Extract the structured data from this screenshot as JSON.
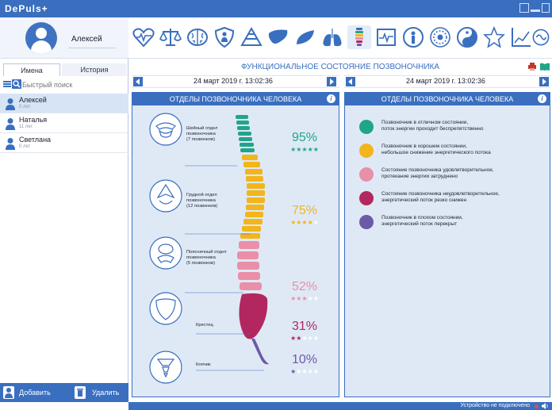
{
  "app": {
    "title": "DePuls+"
  },
  "profile": {
    "name": "Алексей"
  },
  "tabs": [
    {
      "label": "Имена"
    },
    {
      "label": "История"
    }
  ],
  "search": {
    "placeholder": "Быстрый поиск"
  },
  "users": [
    {
      "name": "Алексей",
      "age": "0 лет"
    },
    {
      "name": "Наталья",
      "age": "11 лет"
    },
    {
      "name": "Светлана",
      "age": "0 лет"
    }
  ],
  "bottom": {
    "add_label": "Добавить",
    "delete_label": "Удалить"
  },
  "toolbar": {
    "icons": [
      "heart-pulse-icon",
      "scales-icon",
      "brain-icon",
      "shield-person-icon",
      "pyramid-icon",
      "liver-icon",
      "paw-icon",
      "lungs-icon",
      "spine-icon",
      "ecg-icon",
      "person-circle-icon",
      "mandala-icon",
      "yin-yang-icon",
      "star-icon",
      "chart-icon",
      "loop-icon"
    ],
    "active_index": 8
  },
  "main": {
    "title": "ФУНКЦИОНАЛЬНОЕ СОСТОЯНИЕ ПОЗВОНОЧНИКА",
    "date_left": "24 март 2019 г. 13:02:36",
    "date_right": "24 март 2019 г. 13:02:36"
  },
  "left_panel": {
    "title": "ОТДЕЛЫ ПОЗВОНОЧНИКА ЧЕЛОВЕКА",
    "sections": [
      {
        "label_line1": "Шейный отдел",
        "label_line2": "позвоночника",
        "label_line3": "(7 позвонков)",
        "percent": "95%",
        "percent_value": 95,
        "stars": 5,
        "color": "#21a58a"
      },
      {
        "label_line1": "Грудной отдел",
        "label_line2": "позвоночника",
        "label_line3": "(12 позвонков)",
        "percent": "75%",
        "percent_value": 75,
        "stars": 4,
        "color": "#f2b51b"
      },
      {
        "label_line1": "Поясничный отдел",
        "label_line2": "позвоночника",
        "label_line3": "(5 позвонков)",
        "percent": "52%",
        "percent_value": 52,
        "stars": 3,
        "color": "#e98fa7"
      },
      {
        "label_line1": "Крестец",
        "label_line2": "",
        "label_line3": "",
        "percent": "31%",
        "percent_value": 31,
        "stars": 2,
        "color": "#b2275f"
      },
      {
        "label_line1": "Копчик",
        "label_line2": "",
        "label_line3": "",
        "percent": "10%",
        "percent_value": 10,
        "stars": 1,
        "color": "#6c5aa7"
      }
    ]
  },
  "right_panel": {
    "title": "ОТДЕЛЫ ПОЗВОНОЧНИКА ЧЕЛОВЕКА",
    "legend": [
      {
        "color": "#21a58a",
        "line1": "Позвоночник в отличном состоянии,",
        "line2": "поток энергии проходит беспрепятственно"
      },
      {
        "color": "#f2b51b",
        "line1": "Позвоночник в хорошем состоянии,",
        "line2": "небольшое снижение энергетического потока"
      },
      {
        "color": "#e98fa7",
        "line1": "Состояние позвоночника удовлетворительное,",
        "line2": "протекание энергии затруднено"
      },
      {
        "color": "#b2275f",
        "line1": "Состояние позвоночника неудовлетворительное,",
        "line2": "энергетический поток резко снижен"
      },
      {
        "color": "#6c5aa7",
        "line1": "Позвоночник в плохом состоянии,",
        "line2": "энергетический поток перекрыт"
      }
    ]
  },
  "status": {
    "text": "Устройство не подключено"
  },
  "colors": {
    "accent": "#3a6fbf",
    "panel_bg": "#dfe9f6"
  }
}
